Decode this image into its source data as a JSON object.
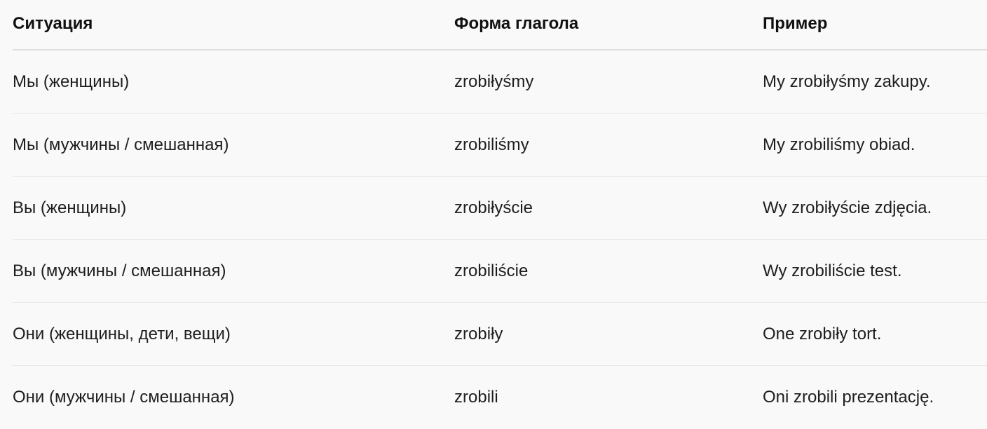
{
  "table": {
    "headers": [
      "Ситуация",
      "Форма глагола",
      "Пример"
    ],
    "rows": [
      [
        "Мы (женщины)",
        "zrobiłyśmy",
        "My zrobiłyśmy zakupy."
      ],
      [
        "Мы (мужчины / смешанная)",
        "zrobiliśmy",
        "My zrobiliśmy obiad."
      ],
      [
        "Вы (женщины)",
        "zrobiłyście",
        "Wy zrobiłyście zdjęcia."
      ],
      [
        "Вы (мужчины / смешанная)",
        "zrobiliście",
        "Wy zrobiliście test."
      ],
      [
        "Они (женщины, дети, вещи)",
        "zrobiły",
        "One zrobiły tort."
      ],
      [
        "Они (мужчины / смешанная)",
        "zrobili",
        "Oni zrobili prezentację."
      ]
    ]
  }
}
